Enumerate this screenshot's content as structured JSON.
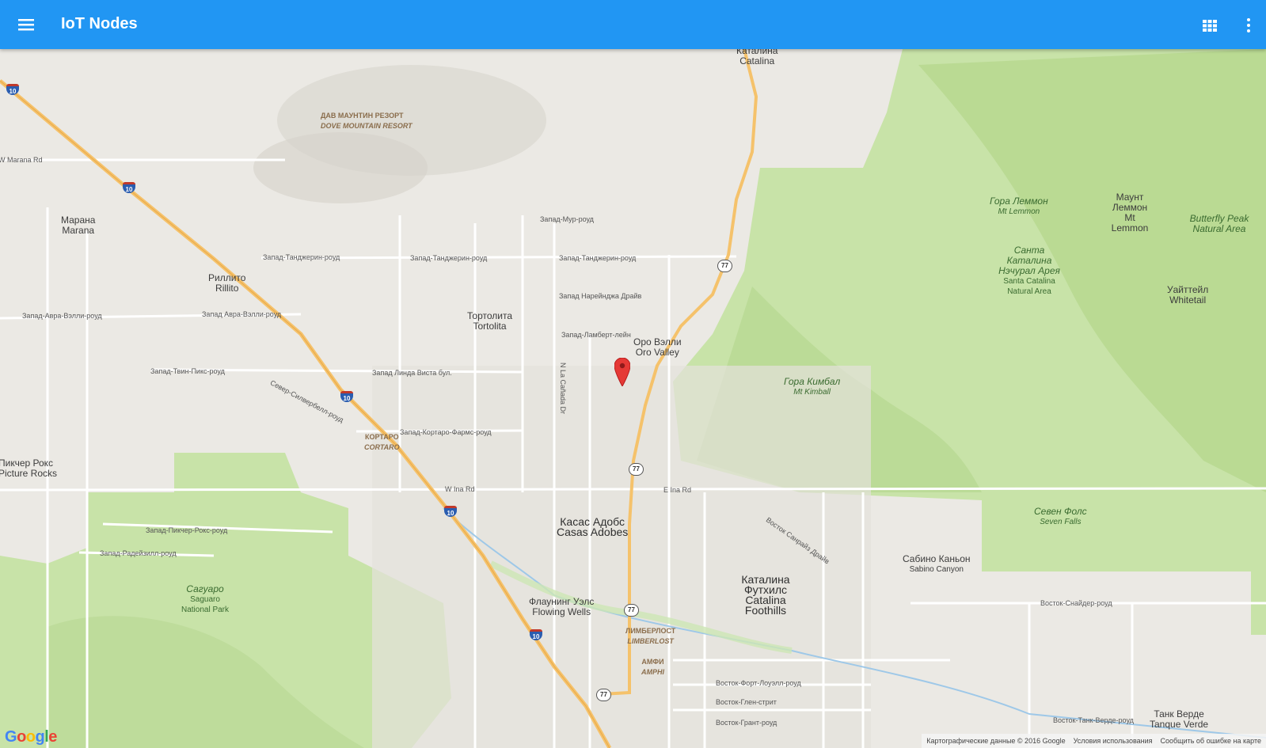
{
  "app": {
    "title": "IoT Nodes"
  },
  "toolbar": {
    "menu_icon": "menu-icon",
    "apps_icon": "apps-icon",
    "more_icon": "more-vert-icon"
  },
  "map": {
    "marker": {
      "icon": "map-marker-icon",
      "color": "#e53935"
    },
    "places": {
      "catalina_ru": "Каталина",
      "catalina_en": "Catalina",
      "dove_ru": "ДАВ МАУНТИН РЕЗОРТ",
      "dove_en": "DOVE MOUNTAIN RESORT",
      "marana_ru": "Марана",
      "marana_en": "Marana",
      "rillito_ru": "Риллито",
      "rillito_en": "Rillito",
      "tortolita_ru": "Тортолита",
      "tortolita_en": "Tortolita",
      "oro_ru": "Оро Вэлли",
      "oro_en": "Oro Valley",
      "cortaro_ru": "КОРТАРО",
      "cortaro_en": "CORTARO",
      "picture_ru": "Пикчер Рокс",
      "picture_en": "Picture Rocks",
      "casas_ru": "Касас Адобс",
      "casas_en": "Casas Adobes",
      "flowing_ru": "Флаунинг Уэлс",
      "flowing_en": "Flowing Wells",
      "limberlost_ru": "ЛИМБЕРЛОСТ",
      "limberlost_en": "LIMBERLOST",
      "amphi_ru": "АМФИ",
      "amphi_en": "AMPHI",
      "foothills_ru": "Каталина Футхилс",
      "foothills_en": "Catalina Foothills",
      "sabino_ru": "Сабино Каньон",
      "sabino_en": "Sabino Canyon",
      "tanque_ru": "Танк Верде",
      "tanque_en": "Tanque Verde",
      "lemmon_ru": "Гора Леммон",
      "lemmon_en": "Mt Lemmon",
      "mtlemmon_ru": "Маунт Леммон",
      "mtlemmon_en": "Mt Lemmon",
      "butterfly_en": "Butterfly Peak Natural Area",
      "santa_ru": "Санта Каталина Нэчурал Арея",
      "santa_en": "Santa Catalina Natural Area",
      "whitetail_ru": "Уайттейл",
      "whitetail_en": "Whitetail",
      "kimball_ru": "Гора Кимбал",
      "kimball_en": "Mt Kimball",
      "seven_ru": "Севен Фолс",
      "seven_en": "Seven Falls",
      "saguaro_ru": "Сагуаро",
      "saguaro_en": "Saguaro National Park"
    },
    "roads": {
      "w_marana": "W Marana Rd",
      "mur": "Запад-Мур-роуд",
      "tangerine1": "Запад-Танджерин-роуд",
      "tangerine2": "Запад-Танджерин-роуд",
      "tangerine3": "Запад-Танджерин-роуд",
      "naranja": "Запад Нарейнджа Драйв",
      "lambert": "Запад-Ламберт-лейн",
      "avra1": "Запад-Авра-Вэлли-роуд",
      "avra2": "Запад Авра-Вэлли-роуд",
      "twin": "Запад-Твин-Пикс-роуд",
      "linda": "Запад Линда Виста бул.",
      "cortaro_farms": "Запад-Кортаро-Фармс-роуд",
      "w_ina": "W Ina Rd",
      "e_ina": "E Ina Rd",
      "picture": "Запад-Пикчер-Рокс-роуд",
      "radeisill": "Запад-Радейзилл-роуд",
      "snyder": "Восток-Снайдер-роуд",
      "fort": "Восток-Форт-Лоуэлл-роуд",
      "glenn": "Восток-Глен-стрит",
      "grant": "Восток-Грант-роуд",
      "tanque_rd": "Восток-Танк-Верде-роуд",
      "sunrise": "Восток Санрайз Драйв",
      "n_la_canada": "N La Cañada Dr",
      "silverbell": "Север-Силвербелл-роуд"
    },
    "shields": {
      "i10": "10",
      "sr77": "77"
    }
  },
  "footer": {
    "map_data": "Картографические данные © 2016 Google",
    "terms": "Условия использования",
    "report": "Сообщить об ошибке на карте"
  },
  "colors": {
    "appbar": "#2196f3",
    "park": "#c8e3a8",
    "mountain": "#b7d98f",
    "highway": "#f5c26b"
  }
}
